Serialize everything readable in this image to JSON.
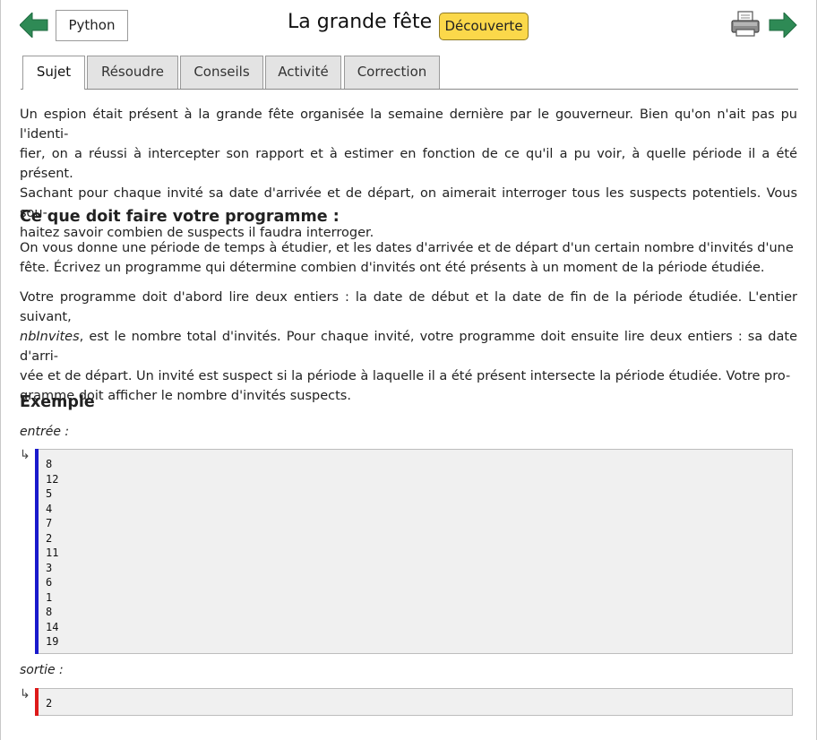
{
  "header": {
    "language": "Python",
    "title": "La grande fête",
    "level": "Découverte",
    "colors": {
      "arrow": "#2e8a55",
      "badge": "#fbd84a"
    },
    "icons": [
      "arrow-left-icon",
      "printer-icon",
      "arrow-right-icon"
    ]
  },
  "tabs": [
    {
      "label": "Sujet",
      "active": true
    },
    {
      "label": "Résoudre",
      "active": false
    },
    {
      "label": "Conseils",
      "active": false
    },
    {
      "label": "Activité",
      "active": false
    },
    {
      "label": "Correction",
      "active": false
    }
  ],
  "intro": {
    "lines": [
      "Un espion était présent à la grande fête organisée la semaine dernière par le gouverneur. Bien qu'on n'ait pas pu l'identi-",
      "fier, on a réussi à intercepter son rapport et à estimer en fonction de ce qu'il a pu voir, à quelle période il a été présent.",
      "Sachant pour chaque invité sa date d'arrivée et de départ, on aimerait interroger tous les suspects potentiels. Vous sou-",
      "haitez savoir combien de suspects il faudra interroger."
    ]
  },
  "task": {
    "heading": "Ce que doit faire votre programme :",
    "p1_lines": [
      "On vous donne une période de temps à étudier, et les dates d'arrivée et de départ d'un certain nombre d'invités d'une",
      "fête. Écrivez un programme qui détermine combien d'invités ont été présents à un moment de la période étudiée."
    ],
    "p2_line1": "Votre programme doit d'abord lire deux entiers : la date de début et la date de fin de la période étudiée. L'entier suivant,",
    "p2_var": "nbInvites",
    "p2_line2_rest": ", est le nombre total d'invités. Pour chaque invité, votre programme doit ensuite lire deux entiers : sa date d'arri-",
    "p2_lines_rest": [
      "vée et de départ. Un invité est suspect si la période à laquelle il a été présent intersecte la période étudiée. Votre pro-",
      "gramme doit afficher le nombre d'invités suspects."
    ]
  },
  "example": {
    "heading": "Exemple",
    "input_label": "entrée :",
    "output_label": "sortie :",
    "return_glyph": "↳",
    "input_lines": [
      "8",
      "12",
      "5",
      "4",
      "7",
      "2",
      "11",
      "3",
      "6",
      "1",
      "8",
      "14",
      "19"
    ],
    "output_lines": [
      "2"
    ],
    "colors": {
      "input_bar": "#1a1acc",
      "output_bar": "#dd1a1a"
    }
  }
}
